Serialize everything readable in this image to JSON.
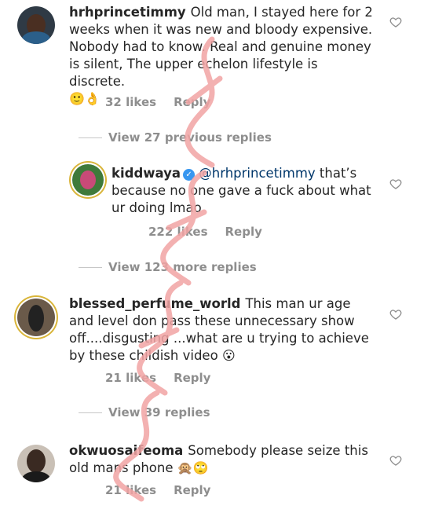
{
  "comments": [
    {
      "username": "hrhprincetimmy",
      "text": "Old man, I stayed here for 2 weeks when it was new and bloody expensive. Nobody had to know. Real and genuine  money is silent, The upper echelon lifestyle is discrete.",
      "emoji": "🙂👌",
      "likes": "32 likes",
      "reply": "Reply",
      "view_replies": "View 27 previous replies"
    },
    {
      "username": "kiddwaya",
      "mention": "@hrhprincetimmy",
      "text": "that’s because no one gave a fuck about what ur doing lmao",
      "likes": "222 likes",
      "reply": "Reply",
      "view_replies": "View 123 more replies"
    },
    {
      "username": "blessed_perfume_world",
      "text": "This man ur age and level don pass these unnecessary show off....disgusting ...what are u trying to achieve by these childish video",
      "emoji": "😮",
      "likes": "21 likes",
      "reply": "Reply",
      "view_replies": "View 39 replies"
    },
    {
      "username": "okwuosaifeoma",
      "text": "Somebody please seize this old mans phone",
      "emoji": "🙊🙄",
      "likes": "21 likes",
      "reply": "Reply"
    }
  ],
  "colors": {
    "text": "#262626",
    "meta": "#8e8e8e",
    "mention": "#00376b",
    "verified": "#3897f0",
    "watermark": "#f2a4a4"
  }
}
